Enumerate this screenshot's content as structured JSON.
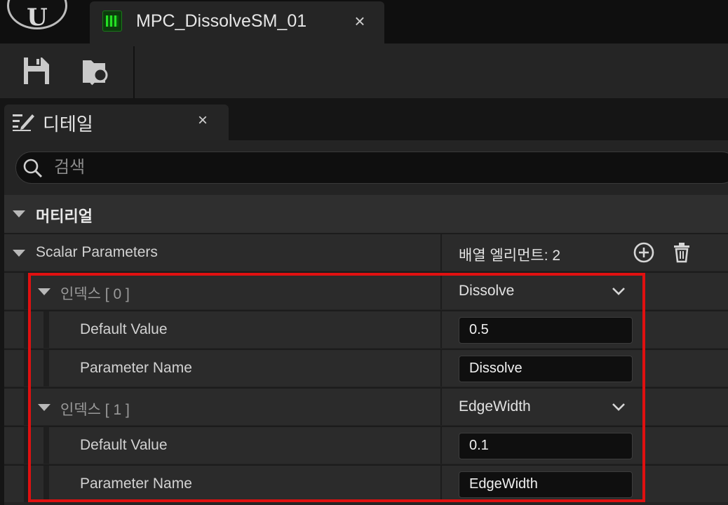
{
  "window": {
    "asset_tab_title": "MPC_DissolveSM_01",
    "close_glyph": "×"
  },
  "toolbar": {
    "buttons": [
      {
        "name": "save",
        "icon": "floppy-disk-icon"
      },
      {
        "name": "browse",
        "icon": "folder-search-icon"
      }
    ]
  },
  "details": {
    "tab_title": "디테일",
    "close_glyph": "×",
    "search_placeholder": "검색"
  },
  "category": {
    "title": "머티리얼"
  },
  "scalar_parameters": {
    "label": "Scalar Parameters",
    "array_count_text": "배열 엘리먼트: 2",
    "elements": [
      {
        "index_label": "인덱스 [ 0 ]",
        "selected_name": "Dissolve",
        "default_value_label": "Default Value",
        "default_value": "0.5",
        "parameter_name_label": "Parameter Name",
        "parameter_name": "Dissolve"
      },
      {
        "index_label": "인덱스 [ 1 ]",
        "selected_name": "EdgeWidth",
        "default_value_label": "Default Value",
        "default_value": "0.1",
        "parameter_name_label": "Parameter Name",
        "parameter_name": "EdgeWidth"
      }
    ]
  },
  "colors": {
    "highlight_border": "#e01010",
    "background": "#242424",
    "field_background": "#0f0f0f"
  }
}
